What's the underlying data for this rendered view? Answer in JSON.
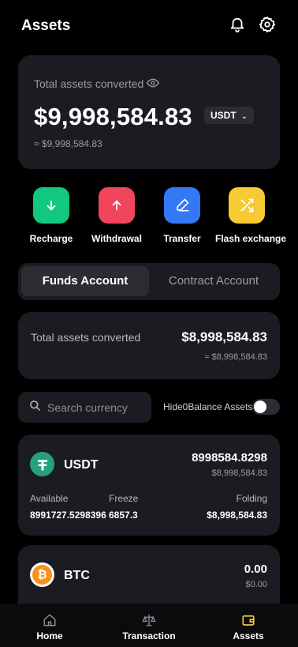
{
  "header": {
    "title": "Assets"
  },
  "total": {
    "label": "Total assets converted",
    "amount": "$9,998,584.83",
    "currency": "USDT",
    "approx": "≈ $9,998,584.83"
  },
  "actions": [
    {
      "label": "Recharge",
      "color": "#12c77f",
      "icon": "arrow-down-icon"
    },
    {
      "label": "Withdrawal",
      "color": "#f0455b",
      "icon": "arrow-up-icon"
    },
    {
      "label": "Transfer",
      "color": "#3478f6",
      "icon": "transfer-icon"
    },
    {
      "label": "Flash exchange",
      "color": "#f7c933",
      "icon": "shuffle-icon"
    }
  ],
  "account_tabs": {
    "funds": "Funds Account",
    "contract": "Contract Account"
  },
  "funds": {
    "label": "Total assets converted",
    "value": "$8,998,584.83",
    "approx": "≈ $8,998,584.83"
  },
  "search": {
    "placeholder": "Search currency"
  },
  "hide_zero": {
    "label": "Hide0Balance Assets",
    "enabled": false
  },
  "coins": [
    {
      "name": "USDT",
      "amount": "8998584.8298",
      "fiat": "$8,998,584.83",
      "available_label": "Available",
      "available": "8991727.5298396",
      "freeze_label": "Freeze",
      "freeze": "6857.3",
      "folding_label": "Folding",
      "folding": "$8,998,584.83",
      "color": "#26a17b"
    },
    {
      "name": "BTC",
      "amount": "0.00",
      "fiat": "$0.00",
      "color": "#f7931a"
    }
  ],
  "tabbar": {
    "home": "Home",
    "transaction": "Transaction",
    "assets": "Assets",
    "active_color": "#f7c933"
  }
}
